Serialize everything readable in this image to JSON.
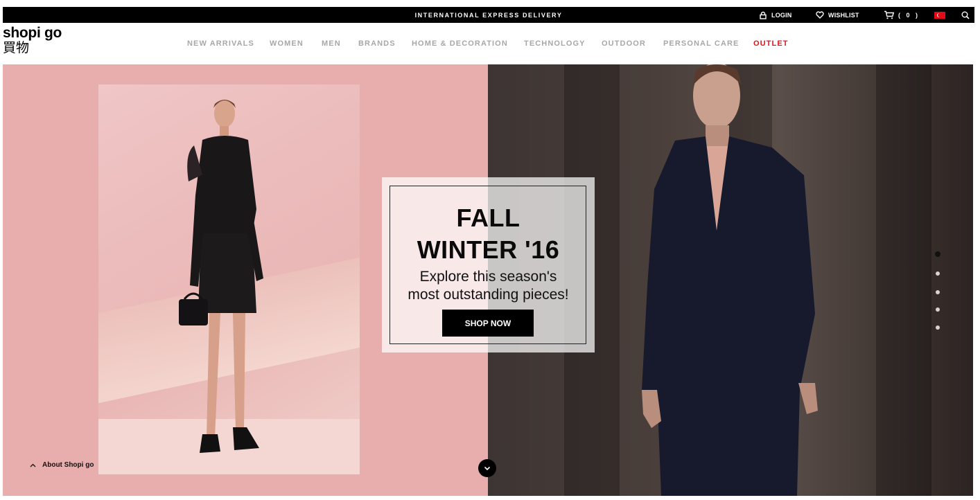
{
  "topbar": {
    "promo": "INTERNATIONAL EXPRESS DELIVERY",
    "login": "LOGIN",
    "wishlist": "WISHLIST",
    "cart_count": "( 0 )"
  },
  "brand": {
    "name": "shopi go",
    "chinese": "買物"
  },
  "nav": {
    "items": [
      {
        "label": "NEW ARRIVALS"
      },
      {
        "label": "WOMEN"
      },
      {
        "label": "MEN"
      },
      {
        "label": "BRANDS"
      },
      {
        "label": "HOME & DECORATION"
      },
      {
        "label": "TECHNOLOGY"
      },
      {
        "label": "OUTDOOR"
      },
      {
        "label": "PERSONAL CARE"
      },
      {
        "label": "OUTLET"
      }
    ]
  },
  "hero": {
    "title_line1": "FALL",
    "title_line2": "WINTER '16",
    "subtitle_line1": "Explore this season's",
    "subtitle_line2": "most outstanding pieces!",
    "cta": "SHOP NOW",
    "slides_total": 5,
    "active_slide": 1
  },
  "footer": {
    "about": "About Shopi go"
  },
  "colors": {
    "accent_outlet": "#e0141c",
    "hero_left_bg": "#e8aeae",
    "nav_text": "#a7a7a7"
  },
  "icons": [
    "login-lock-icon",
    "heart-icon",
    "cart-icon",
    "turkey-flag-icon",
    "search-icon",
    "chevron-up-icon",
    "chevron-down-icon"
  ]
}
